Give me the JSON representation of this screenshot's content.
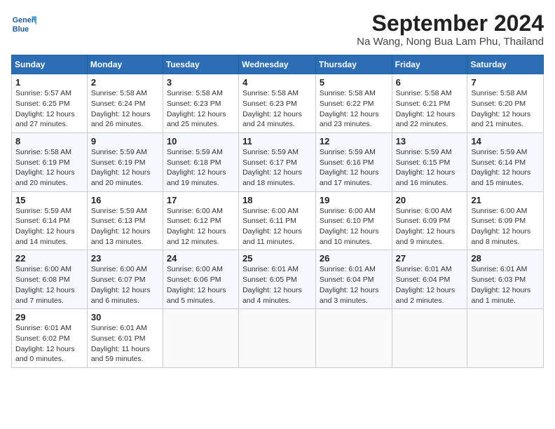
{
  "header": {
    "logo_line1": "General",
    "logo_line2": "Blue",
    "month": "September 2024",
    "location": "Na Wang, Nong Bua Lam Phu, Thailand"
  },
  "weekdays": [
    "Sunday",
    "Monday",
    "Tuesday",
    "Wednesday",
    "Thursday",
    "Friday",
    "Saturday"
  ],
  "weeks": [
    [
      {
        "day": "1",
        "sunrise": "5:57 AM",
        "sunset": "6:25 PM",
        "daylight": "12 hours and 27 minutes."
      },
      {
        "day": "2",
        "sunrise": "5:58 AM",
        "sunset": "6:24 PM",
        "daylight": "12 hours and 26 minutes."
      },
      {
        "day": "3",
        "sunrise": "5:58 AM",
        "sunset": "6:23 PM",
        "daylight": "12 hours and 25 minutes."
      },
      {
        "day": "4",
        "sunrise": "5:58 AM",
        "sunset": "6:23 PM",
        "daylight": "12 hours and 24 minutes."
      },
      {
        "day": "5",
        "sunrise": "5:58 AM",
        "sunset": "6:22 PM",
        "daylight": "12 hours and 23 minutes."
      },
      {
        "day": "6",
        "sunrise": "5:58 AM",
        "sunset": "6:21 PM",
        "daylight": "12 hours and 22 minutes."
      },
      {
        "day": "7",
        "sunrise": "5:58 AM",
        "sunset": "6:20 PM",
        "daylight": "12 hours and 21 minutes."
      }
    ],
    [
      {
        "day": "8",
        "sunrise": "5:58 AM",
        "sunset": "6:19 PM",
        "daylight": "12 hours and 20 minutes."
      },
      {
        "day": "9",
        "sunrise": "5:59 AM",
        "sunset": "6:19 PM",
        "daylight": "12 hours and 20 minutes."
      },
      {
        "day": "10",
        "sunrise": "5:59 AM",
        "sunset": "6:18 PM",
        "daylight": "12 hours and 19 minutes."
      },
      {
        "day": "11",
        "sunrise": "5:59 AM",
        "sunset": "6:17 PM",
        "daylight": "12 hours and 18 minutes."
      },
      {
        "day": "12",
        "sunrise": "5:59 AM",
        "sunset": "6:16 PM",
        "daylight": "12 hours and 17 minutes."
      },
      {
        "day": "13",
        "sunrise": "5:59 AM",
        "sunset": "6:15 PM",
        "daylight": "12 hours and 16 minutes."
      },
      {
        "day": "14",
        "sunrise": "5:59 AM",
        "sunset": "6:14 PM",
        "daylight": "12 hours and 15 minutes."
      }
    ],
    [
      {
        "day": "15",
        "sunrise": "5:59 AM",
        "sunset": "6:14 PM",
        "daylight": "12 hours and 14 minutes."
      },
      {
        "day": "16",
        "sunrise": "5:59 AM",
        "sunset": "6:13 PM",
        "daylight": "12 hours and 13 minutes."
      },
      {
        "day": "17",
        "sunrise": "6:00 AM",
        "sunset": "6:12 PM",
        "daylight": "12 hours and 12 minutes."
      },
      {
        "day": "18",
        "sunrise": "6:00 AM",
        "sunset": "6:11 PM",
        "daylight": "12 hours and 11 minutes."
      },
      {
        "day": "19",
        "sunrise": "6:00 AM",
        "sunset": "6:10 PM",
        "daylight": "12 hours and 10 minutes."
      },
      {
        "day": "20",
        "sunrise": "6:00 AM",
        "sunset": "6:09 PM",
        "daylight": "12 hours and 9 minutes."
      },
      {
        "day": "21",
        "sunrise": "6:00 AM",
        "sunset": "6:09 PM",
        "daylight": "12 hours and 8 minutes."
      }
    ],
    [
      {
        "day": "22",
        "sunrise": "6:00 AM",
        "sunset": "6:08 PM",
        "daylight": "12 hours and 7 minutes."
      },
      {
        "day": "23",
        "sunrise": "6:00 AM",
        "sunset": "6:07 PM",
        "daylight": "12 hours and 6 minutes."
      },
      {
        "day": "24",
        "sunrise": "6:00 AM",
        "sunset": "6:06 PM",
        "daylight": "12 hours and 5 minutes."
      },
      {
        "day": "25",
        "sunrise": "6:01 AM",
        "sunset": "6:05 PM",
        "daylight": "12 hours and 4 minutes."
      },
      {
        "day": "26",
        "sunrise": "6:01 AM",
        "sunset": "6:04 PM",
        "daylight": "12 hours and 3 minutes."
      },
      {
        "day": "27",
        "sunrise": "6:01 AM",
        "sunset": "6:04 PM",
        "daylight": "12 hours and 2 minutes."
      },
      {
        "day": "28",
        "sunrise": "6:01 AM",
        "sunset": "6:03 PM",
        "daylight": "12 hours and 1 minute."
      }
    ],
    [
      {
        "day": "29",
        "sunrise": "6:01 AM",
        "sunset": "6:02 PM",
        "daylight": "12 hours and 0 minutes."
      },
      {
        "day": "30",
        "sunrise": "6:01 AM",
        "sunset": "6:01 PM",
        "daylight": "11 hours and 59 minutes."
      },
      null,
      null,
      null,
      null,
      null
    ]
  ]
}
